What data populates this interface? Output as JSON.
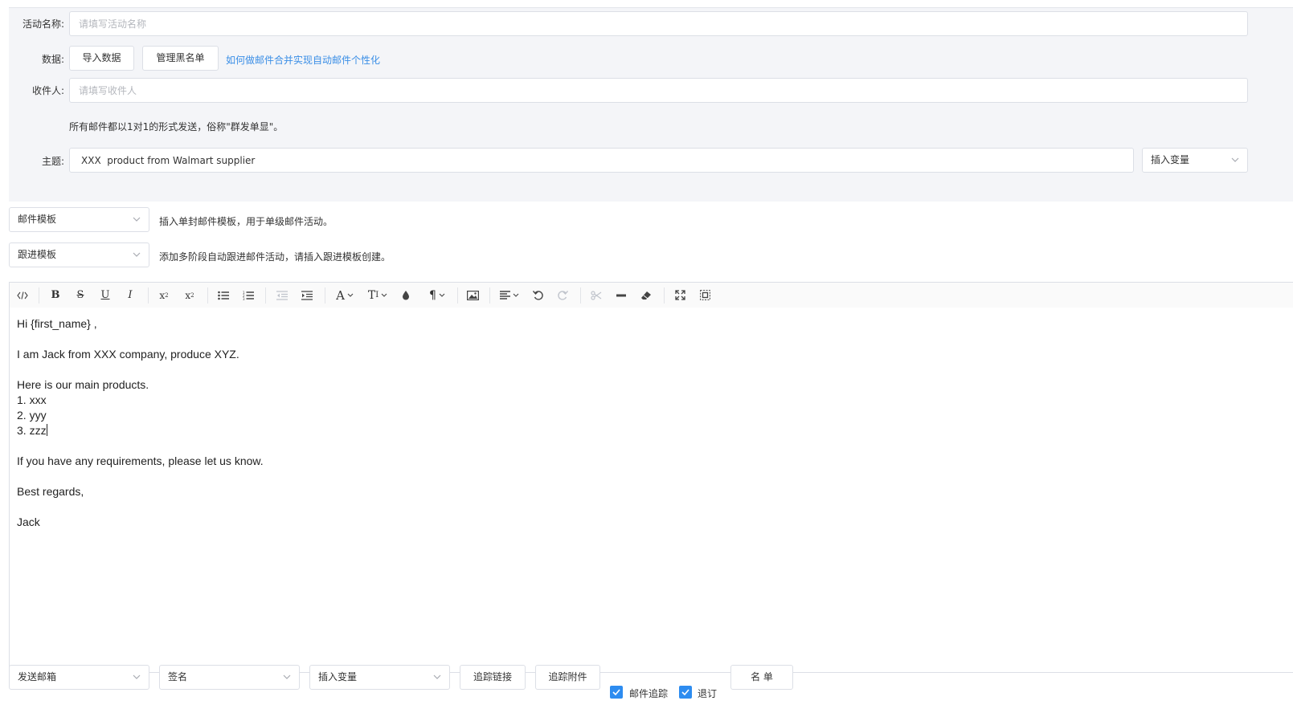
{
  "form": {
    "activity_name_label": "活动名称:",
    "activity_name_placeholder": "请填写活动名称",
    "data_label": "数据:",
    "import_data_button": "导入数据",
    "manage_blacklist_button": "管理黑名单",
    "help_link": "如何做邮件合并实现自动邮件个性化",
    "recipients_label": "收件人:",
    "recipients_placeholder": "请填写收件人",
    "recipients_note": "所有邮件都以1对1的形式发送，俗称\"群发单显\"。",
    "subject_label": "主题:",
    "subject_value": "XXX  product from Walmart supplier",
    "insert_variable_select": "插入变量"
  },
  "templates": {
    "mail_template_select": "邮件模板",
    "mail_template_hint": "插入单封邮件模板，用于单级邮件活动。",
    "followup_template_select": "跟进模板",
    "followup_template_hint": "添加多阶段自动跟进邮件活动，请插入跟进模板创建。"
  },
  "toolbar": {
    "items": [
      {
        "name": "code-view-icon"
      },
      {
        "name": "bold-icon"
      },
      {
        "name": "strikethrough-icon"
      },
      {
        "name": "underline-icon"
      },
      {
        "name": "italic-icon"
      },
      {
        "name": "superscript-icon"
      },
      {
        "name": "subscript-icon"
      },
      {
        "name": "bullet-list-icon"
      },
      {
        "name": "numbered-list-icon"
      },
      {
        "name": "outdent-icon"
      },
      {
        "name": "indent-icon"
      },
      {
        "name": "font-family-icon"
      },
      {
        "name": "font-size-icon"
      },
      {
        "name": "text-color-icon"
      },
      {
        "name": "paragraph-icon"
      },
      {
        "name": "image-icon"
      },
      {
        "name": "align-icon"
      },
      {
        "name": "undo-icon"
      },
      {
        "name": "redo-icon"
      },
      {
        "name": "cut-icon"
      },
      {
        "name": "horizontal-rule-icon"
      },
      {
        "name": "clear-format-icon"
      },
      {
        "name": "fullscreen-icon"
      },
      {
        "name": "select-all-icon"
      }
    ]
  },
  "editor": {
    "lines": [
      "Hi {first_name} ,",
      "",
      "I am Jack from XXX company, produce XYZ.",
      "",
      "Here is our main products.",
      "1. xxx",
      "2. yyy",
      "3. zzz",
      "",
      "If you have any requirements, please let us know.",
      "",
      "Best regards,",
      "",
      "Jack"
    ]
  },
  "footer": {
    "sender_mailbox_select": "发送邮箱",
    "signature_select": "签名",
    "insert_variable_select": "插入变量",
    "track_links_button": "追踪链接",
    "track_attachments_button": "追踪附件",
    "mail_tracking_label": "邮件追踪",
    "mail_tracking_checked": true,
    "unsubscribe_label": "退订",
    "unsubscribe_checked": true,
    "list_button": "名 单"
  },
  "colors": {
    "accent": "#2d8cf0",
    "link": "#3a8ee6",
    "panel_bg": "#f4f5f8",
    "border": "#dcdfe6"
  }
}
